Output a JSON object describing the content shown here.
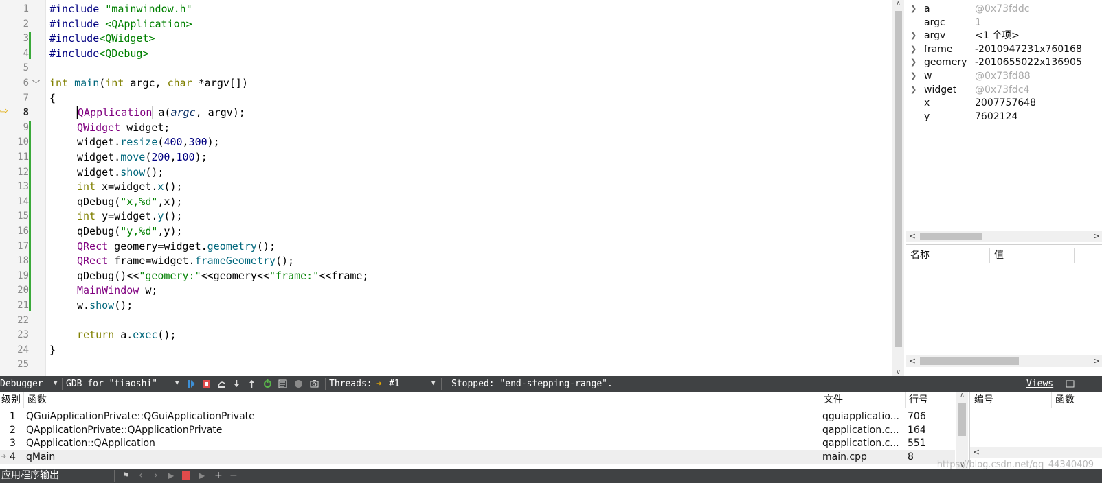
{
  "editor": {
    "line_numbers": [
      "1",
      "2",
      "3",
      "4",
      "5",
      "6",
      "7",
      "8",
      "9",
      "10",
      "11",
      "12",
      "13",
      "14",
      "15",
      "16",
      "17",
      "18",
      "19",
      "20",
      "21",
      "22",
      "23",
      "24",
      "25"
    ],
    "current_line": "8",
    "lines": [
      [
        {
          "t": "#include ",
          "c": "prep"
        },
        {
          "t": "\"mainwindow.h\"",
          "c": "str"
        }
      ],
      [
        {
          "t": "#include ",
          "c": "prep"
        },
        {
          "t": "<QApplication>",
          "c": "str"
        }
      ],
      [
        {
          "t": "#include",
          "c": "prep"
        },
        {
          "t": "<QWidget>",
          "c": "str"
        }
      ],
      [
        {
          "t": "#include",
          "c": "prep"
        },
        {
          "t": "<QDebug>",
          "c": "str"
        }
      ],
      [],
      [
        {
          "t": "int",
          "c": "kw"
        },
        {
          "t": " "
        },
        {
          "t": "main",
          "c": "fn"
        },
        {
          "t": "("
        },
        {
          "t": "int",
          "c": "kw"
        },
        {
          "t": " argc, "
        },
        {
          "t": "char",
          "c": "kw"
        },
        {
          "t": " *argv[])"
        }
      ],
      [
        {
          "t": "{"
        }
      ],
      [
        {
          "i": 1
        },
        {
          "t": "QApplication",
          "c": "type",
          "box": true
        },
        {
          "t": " a("
        },
        {
          "t": "argc",
          "c": "par"
        },
        {
          "t": ", argv);"
        }
      ],
      [
        {
          "i": 1
        },
        {
          "t": "QWidget",
          "c": "type"
        },
        {
          "t": " widget;"
        }
      ],
      [
        {
          "i": 1
        },
        {
          "t": "widget."
        },
        {
          "t": "resize",
          "c": "fn"
        },
        {
          "t": "("
        },
        {
          "t": "400",
          "c": "num"
        },
        {
          "t": ","
        },
        {
          "t": "300",
          "c": "num"
        },
        {
          "t": ");"
        }
      ],
      [
        {
          "i": 1
        },
        {
          "t": "widget."
        },
        {
          "t": "move",
          "c": "fn"
        },
        {
          "t": "("
        },
        {
          "t": "200",
          "c": "num"
        },
        {
          "t": ","
        },
        {
          "t": "100",
          "c": "num"
        },
        {
          "t": ");"
        }
      ],
      [
        {
          "i": 1
        },
        {
          "t": "widget."
        },
        {
          "t": "show",
          "c": "fn"
        },
        {
          "t": "();"
        }
      ],
      [
        {
          "i": 1
        },
        {
          "t": "int",
          "c": "kw"
        },
        {
          "t": " x=widget."
        },
        {
          "t": "x",
          "c": "fn"
        },
        {
          "t": "();"
        }
      ],
      [
        {
          "i": 1
        },
        {
          "t": "qDebug("
        },
        {
          "t": "\"x,%d\"",
          "c": "str"
        },
        {
          "t": ",x);"
        }
      ],
      [
        {
          "i": 1
        },
        {
          "t": "int",
          "c": "kw"
        },
        {
          "t": " y=widget."
        },
        {
          "t": "y",
          "c": "fn"
        },
        {
          "t": "();"
        }
      ],
      [
        {
          "i": 1
        },
        {
          "t": "qDebug("
        },
        {
          "t": "\"y,%d\"",
          "c": "str"
        },
        {
          "t": ",y);"
        }
      ],
      [
        {
          "i": 1
        },
        {
          "t": "QRect",
          "c": "type"
        },
        {
          "t": " geomery=widget."
        },
        {
          "t": "geometry",
          "c": "fn"
        },
        {
          "t": "();"
        }
      ],
      [
        {
          "i": 1
        },
        {
          "t": "QRect",
          "c": "type"
        },
        {
          "t": " frame=widget."
        },
        {
          "t": "frameGeometry",
          "c": "fn"
        },
        {
          "t": "();"
        }
      ],
      [
        {
          "i": 1
        },
        {
          "t": "qDebug()<<"
        },
        {
          "t": "\"geomery:\"",
          "c": "str"
        },
        {
          "t": "<<geomery<<"
        },
        {
          "t": "\"frame:\"",
          "c": "str"
        },
        {
          "t": "<<frame;"
        }
      ],
      [
        {
          "i": 1
        },
        {
          "t": "MainWindow",
          "c": "type"
        },
        {
          "t": " w;"
        }
      ],
      [
        {
          "i": 1
        },
        {
          "t": "w."
        },
        {
          "t": "show",
          "c": "fn"
        },
        {
          "t": "();"
        }
      ],
      [],
      [
        {
          "i": 1
        },
        {
          "t": "return",
          "c": "kw"
        },
        {
          "t": " a."
        },
        {
          "t": "exec",
          "c": "fn"
        },
        {
          "t": "();"
        }
      ],
      [
        {
          "t": "}"
        }
      ],
      []
    ]
  },
  "locals": [
    {
      "name": "a",
      "value": "@0x73fddc",
      "expandable": true,
      "gray": true
    },
    {
      "name": "argc",
      "value": "1",
      "expandable": false,
      "gray": false
    },
    {
      "name": "argv",
      "value": "<1 个项>",
      "expandable": true,
      "gray": false
    },
    {
      "name": "frame",
      "value": "-2010947231x760168",
      "expandable": true,
      "gray": false
    },
    {
      "name": "geomery",
      "value": "-2010655022x136905",
      "expandable": true,
      "gray": false
    },
    {
      "name": "w",
      "value": "@0x73fd88",
      "expandable": true,
      "gray": true
    },
    {
      "name": "widget",
      "value": "@0x73fdc4",
      "expandable": true,
      "gray": true
    },
    {
      "name": "x",
      "value": "2007757648",
      "expandable": false,
      "gray": false
    },
    {
      "name": "y",
      "value": "7602124",
      "expandable": false,
      "gray": false
    }
  ],
  "watch": {
    "col_name": "名称",
    "col_value": "值"
  },
  "debugger_bar": {
    "mode": "Debugger",
    "engine": "GDB for \"tiaoshi\"",
    "threads_label": "Threads:",
    "thread": "#1",
    "status": "Stopped: \"end-stepping-range\".",
    "views": "Views"
  },
  "stack": {
    "headers": {
      "level": "级别",
      "function": "函数",
      "file": "文件",
      "line": "行号"
    },
    "rows": [
      {
        "level": "1",
        "function": "QGuiApplicationPrivate::QGuiApplicationPrivate",
        "file": "qguiapplicatio...",
        "line": "706",
        "current": false
      },
      {
        "level": "2",
        "function": "QApplicationPrivate::QApplicationPrivate",
        "file": "qapplication.c...",
        "line": "164",
        "current": false
      },
      {
        "level": "3",
        "function": "QApplication::QApplication",
        "file": "qapplication.c...",
        "line": "551",
        "current": false
      },
      {
        "level": "4",
        "function": "qMain",
        "file": "main.cpp",
        "line": "8",
        "current": true
      }
    ]
  },
  "breakpoints": {
    "headers": {
      "number": "编号",
      "function": "函数"
    }
  },
  "output_bar": {
    "label": "应用程序输出"
  },
  "watermark": "https://blog.csdn.net/qq_44340409"
}
